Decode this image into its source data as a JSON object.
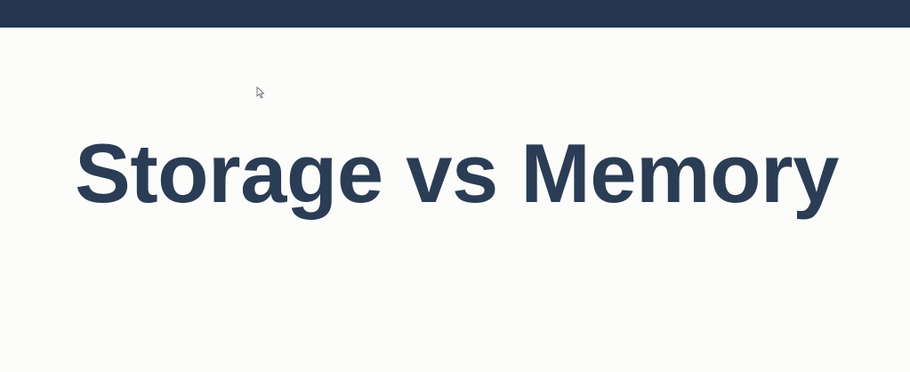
{
  "slide": {
    "title": "Storage vs Memory"
  },
  "colors": {
    "top_bar": "#24364e",
    "title_text": "#2b3d55",
    "background": "#fcfcfb"
  }
}
